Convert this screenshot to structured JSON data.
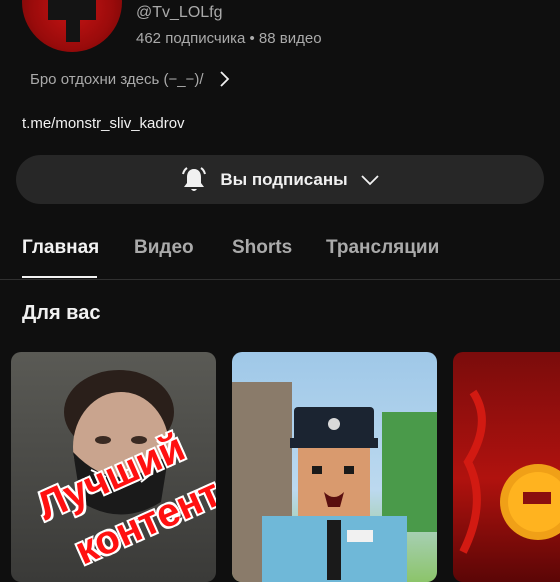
{
  "channel": {
    "handle": "@Tv_LOLfg",
    "stats": "462 подписчика • 88 видео",
    "description": "Бро отдохни здесь (−_−)/",
    "link": "t.me/monstr_sliv_kadrov"
  },
  "subscribe": {
    "label": "Вы подписаны"
  },
  "tabs": [
    {
      "label": "Главная",
      "active": true
    },
    {
      "label": "Видео",
      "active": false
    },
    {
      "label": "Shorts",
      "active": false
    },
    {
      "label": "Трансляции",
      "active": false
    }
  ],
  "section": {
    "title": "Для вас"
  },
  "videos": [
    {
      "overlay_line1": "Лучший",
      "overlay_line2": "контент"
    },
    {
      "overlay_line1": null
    },
    {
      "overlay_line1": null
    }
  ],
  "icons": {
    "description_more": "chevron-right-icon",
    "notifications": "bell-icon",
    "subscribe_menu": "chevron-down-icon"
  }
}
